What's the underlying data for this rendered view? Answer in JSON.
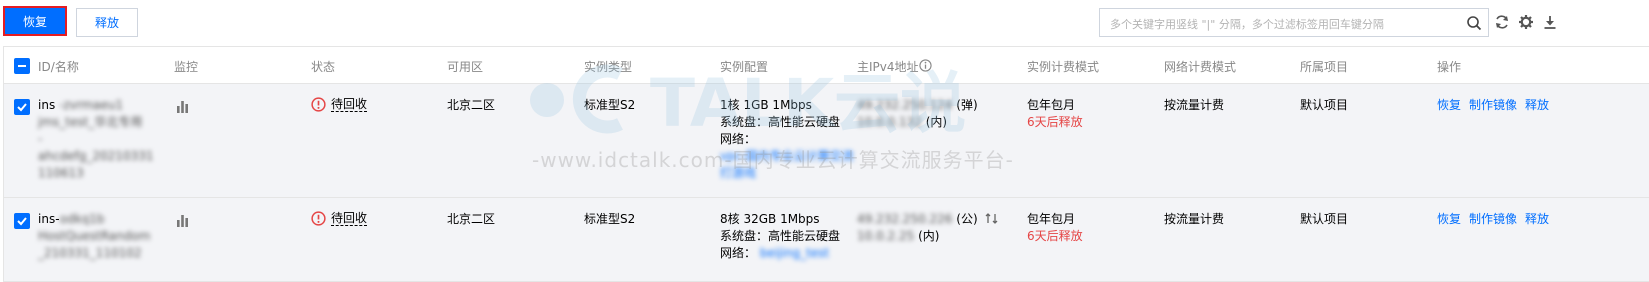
{
  "toolbar": {
    "restore_label": "恢复",
    "release_label": "释放",
    "search_placeholder": "多个关键字用竖线 \"|\" 分隔，多个过滤标签用回车键分隔"
  },
  "columns": [
    "ID/名称",
    "监控",
    "状态",
    "可用区",
    "实例类型",
    "实例配置",
    "主IPv4地址",
    "实例计费模式",
    "网络计费模式",
    "所属项目",
    "操作"
  ],
  "rows": [
    {
      "id_prefix": "ins",
      "id_blurred_lines": [
        "-zvrmaeu1",
        "jms_test_华北专用",
        "-",
        "ahcdefg_20210331",
        "110613"
      ],
      "status": "待回收",
      "zone": "北京二区",
      "type": "标准型S2",
      "config": [
        "1核 1GB 1Mbps",
        "系统盘：高性能云硬盘",
        "网络："
      ],
      "network_blurred": [
        "vpc-国内专业云计算交流",
        "打游戏"
      ],
      "ip_public": "49.232.250.124",
      "ip_public_tag": "(弹)",
      "ip_private": "10.0.0.132",
      "ip_private_tag": "(内)",
      "billing": "包年包月",
      "billing_note": "6天后释放",
      "net_billing": "按流量计费",
      "project": "默认项目",
      "ops": [
        "恢复",
        "制作镜像",
        "释放"
      ]
    },
    {
      "id_prefix": "ins-",
      "id_blurred_lines": [
        "odkq1b",
        "HostQuestRandom",
        "_210331_110102"
      ],
      "status": "待回收",
      "zone": "北京二区",
      "type": "标准型S2",
      "config": [
        "8核 32GB 1Mbps",
        "系统盘：高性能云硬盘",
        "网络："
      ],
      "network_blurred": [
        "beijing_test"
      ],
      "ip_public": "49.232.250.226",
      "ip_public_tag": "(公)",
      "ip_private": "10.0.2.25",
      "ip_private_tag": "(内)",
      "billing": "包年包月",
      "billing_note": "6天后释放",
      "net_billing": "按流量计费",
      "project": "默认项目",
      "ops": [
        "恢复",
        "制作镜像",
        "释放"
      ]
    }
  ],
  "watermark": {
    "logo_text": "TALK云说",
    "tagline": "-www.idctalk.com-国内专业云计算交流服务平台-"
  },
  "colors": {
    "primary": "#006eff",
    "danger": "#e54545",
    "highlight_border": "#e51c23"
  },
  "icons": [
    "search-icon",
    "refresh-icon",
    "settings-icon",
    "download-icon",
    "bar-chart-icon",
    "warning-circle-icon",
    "info-icon",
    "switch-icon",
    "checkbox-checked-icon"
  ]
}
